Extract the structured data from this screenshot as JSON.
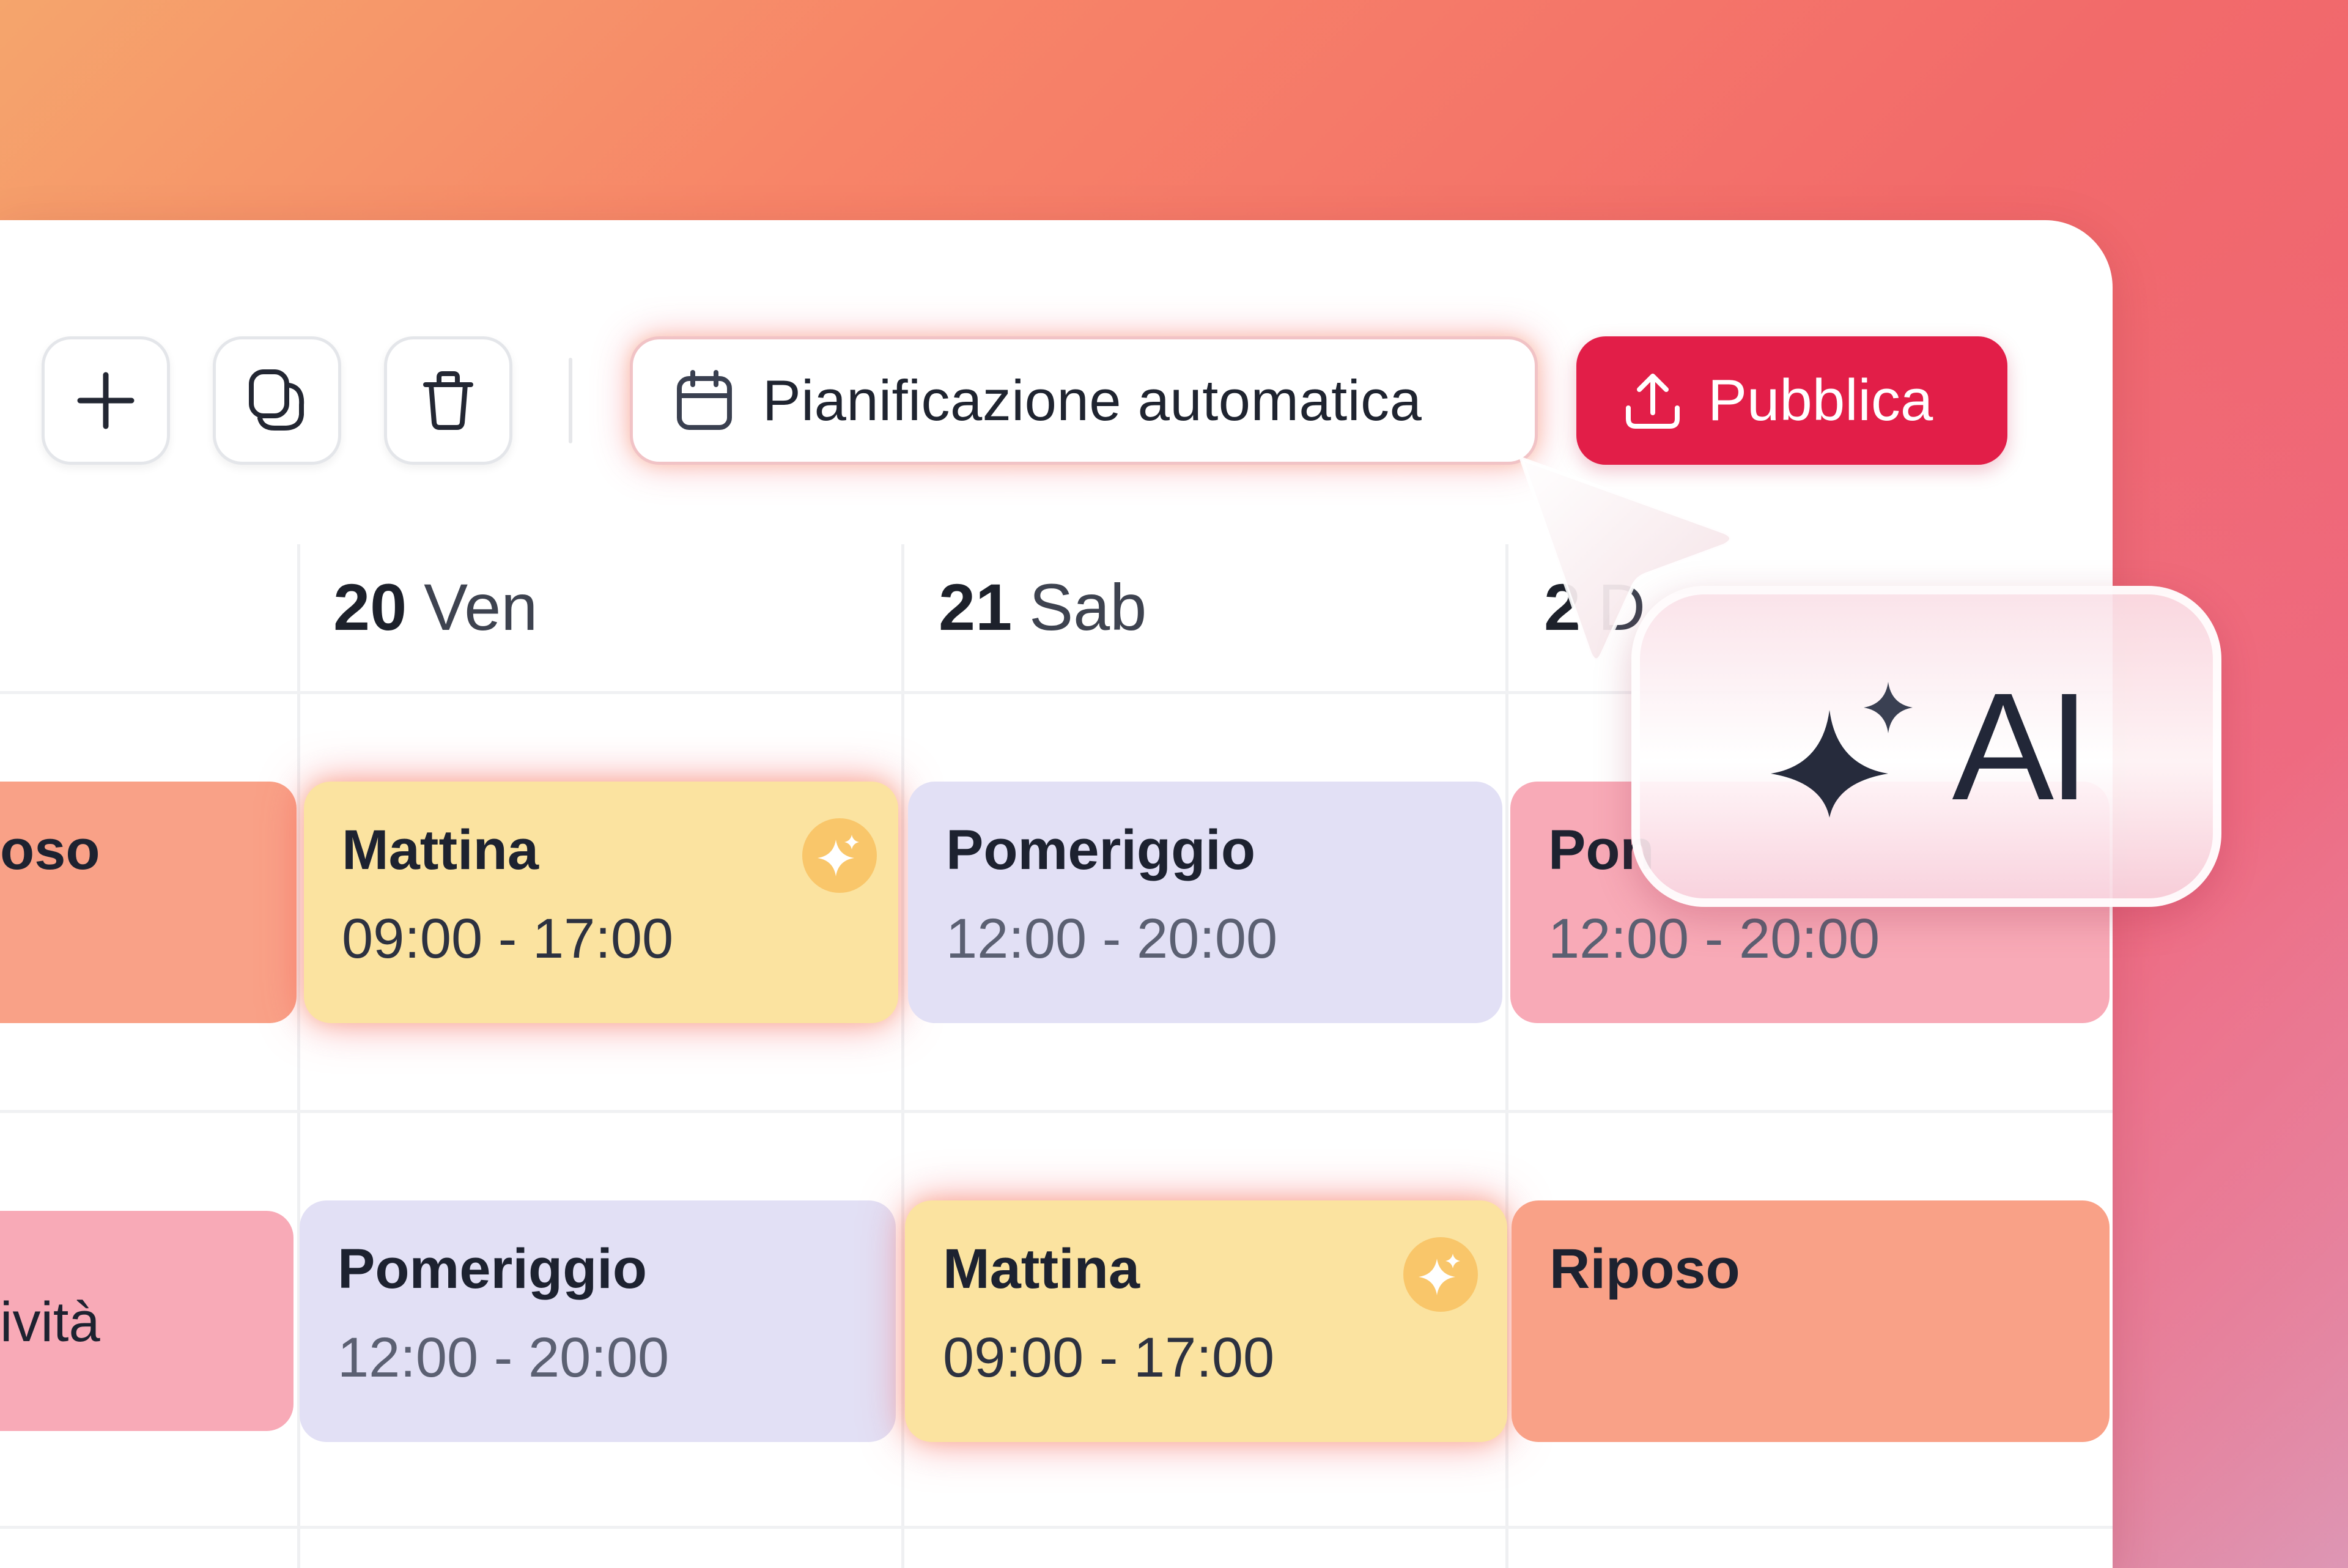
{
  "toolbar": {
    "add_button": "+",
    "auto_plan_label": "Pianificazione automatica",
    "publish_label": "Pubblica"
  },
  "days": [
    {
      "num": "20",
      "name": "Ven"
    },
    {
      "num": "21",
      "name": "Sab"
    },
    {
      "num": "2",
      "name": "D"
    }
  ],
  "rows": [
    {
      "partial_label": "oso",
      "shifts": [
        {
          "title": "Mattina",
          "time": "09:00 - 17:00",
          "ai": true
        },
        {
          "title": "Pomeriggio",
          "time": "12:00 - 20:00",
          "ai": false
        },
        {
          "title": "Pon",
          "time": "12:00 - 20:00",
          "ai": false
        }
      ]
    },
    {
      "partial_label": "ività",
      "shifts": [
        {
          "title": "Pomeriggio",
          "time": "12:00 - 20:00",
          "ai": false
        },
        {
          "title": "Mattina",
          "time": "09:00 - 17:00",
          "ai": true
        },
        {
          "title": "Riposo",
          "time": "",
          "ai": false
        }
      ]
    }
  ],
  "ai_badge": {
    "label": "AI"
  },
  "colors": {
    "publish": "#e21e48",
    "morning": "#fbe3a0",
    "afternoon": "#e2e0f5",
    "pink": "#f8aab7",
    "rest": "#f9a187",
    "ai_sparkle": "#f9c66a"
  },
  "icons": [
    "plus-icon",
    "copy-icon",
    "trash-icon",
    "calendar-icon",
    "upload-icon",
    "sparkle-icon",
    "cursor-icon"
  ]
}
